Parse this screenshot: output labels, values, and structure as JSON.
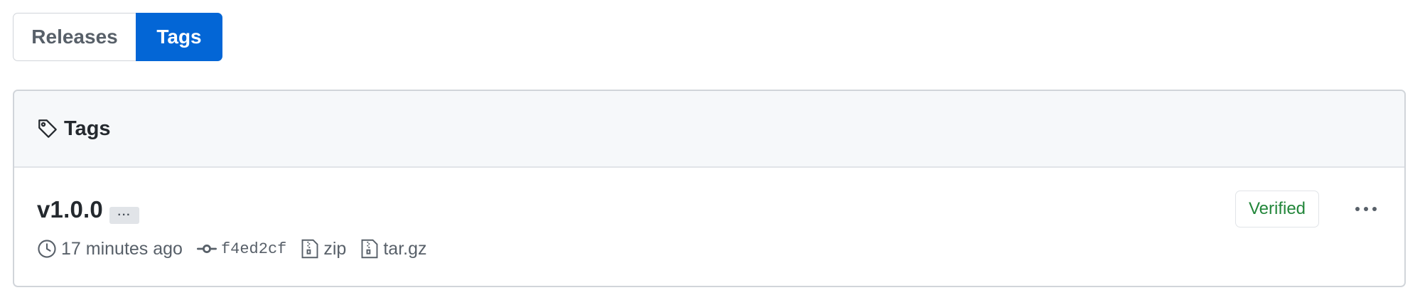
{
  "nav": {
    "releases_label": "Releases",
    "tags_label": "Tags",
    "active_tab": "Tags"
  },
  "panel": {
    "title": "Tags",
    "icon": "tag-icon"
  },
  "tags": [
    {
      "name": "v1.0.0",
      "hidden_text_toggle": "···",
      "time_ago": "17 minutes ago",
      "commit_sha": "f4ed2cf",
      "zip_label": "zip",
      "targz_label": "tar.gz",
      "verified_label": "Verified"
    }
  ],
  "colors": {
    "accent": "#0366d6",
    "verified": "#22863a",
    "muted_text": "#586069",
    "border": "#d1d5da",
    "header_bg": "#f6f8fa"
  }
}
